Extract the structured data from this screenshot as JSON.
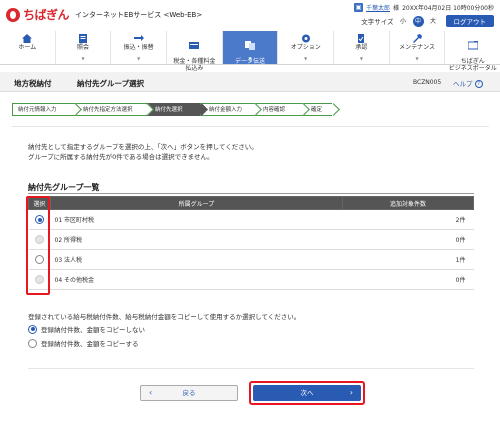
{
  "header": {
    "brand": "ちばぎん",
    "service": "インターネットEBサービス <Web-EB>",
    "user_name": "千葉太郎",
    "user_suffix": "様",
    "datetime": "20XX年04月02日 10時00分00秒",
    "font_size_label": "文字サイズ",
    "font_small": "小",
    "font_medium": "中",
    "font_large": "大",
    "logout": "ログアウト"
  },
  "nav": {
    "items": [
      {
        "label": "ホーム",
        "icon": "home-icon"
      },
      {
        "label": "照会",
        "icon": "inquiry-icon"
      },
      {
        "label": "振込・振替",
        "icon": "transfer-icon"
      },
      {
        "label": "税金・各種料金\n払込み",
        "icon": "tax-payment-icon"
      },
      {
        "label": "データ伝送\n(総合振込等)",
        "icon": "data-transfer-icon"
      },
      {
        "label": "オプション",
        "icon": "option-icon"
      },
      {
        "label": "承認",
        "icon": "approval-icon"
      },
      {
        "label": "メンテナンス",
        "icon": "maintenance-icon"
      },
      {
        "label": "ちばぎん\nビジネスポータル",
        "icon": "portal-icon"
      }
    ],
    "active_index": 4
  },
  "page": {
    "title_main": "地方税納付",
    "title_sub": "納付先グループ選択",
    "screen_code": "BCZN005",
    "help": "ヘルプ"
  },
  "steps": [
    {
      "label": "納付元情報入力"
    },
    {
      "label": "納付先指定方法選択"
    },
    {
      "label": "納付先選択"
    },
    {
      "label": "納付金額入力"
    },
    {
      "label": "内容確認"
    },
    {
      "label": "確定"
    }
  ],
  "current_step": 2,
  "intro": {
    "line1": "納付先として指定するグループを選択の上、「次へ」ボタンを押してください。",
    "line2": "グループに所属する納付先が0件である場合は選択できません。"
  },
  "group_section": {
    "title": "納付先グループ一覧",
    "headers": {
      "select": "選択",
      "group": "所属グループ",
      "count": "追加対象件数"
    },
    "rows": [
      {
        "group": "01 市区町村税",
        "count": "2件",
        "state": "checked"
      },
      {
        "group": "02 所得税",
        "count": "0件",
        "state": "disabled"
      },
      {
        "group": "03 法人税",
        "count": "1件",
        "state": "unchecked"
      },
      {
        "group": "04 その他税金",
        "count": "0件",
        "state": "disabled"
      }
    ]
  },
  "copy_section": {
    "question": "登録されている給与税納付件数、給与税納付金額をコピーして使用するか選択してください。",
    "options": [
      {
        "label": "登録納付件数、金額をコピーしない",
        "checked": true
      },
      {
        "label": "登録納付件数、金額をコピーする",
        "checked": false
      }
    ]
  },
  "buttons": {
    "back": "戻る",
    "next": "次へ"
  },
  "colors": {
    "accent": "#2a5bb3",
    "brand_red": "#d9282f",
    "highlight": "#e8171f",
    "step_current": "#555555",
    "step_border": "#4a9a4a"
  }
}
